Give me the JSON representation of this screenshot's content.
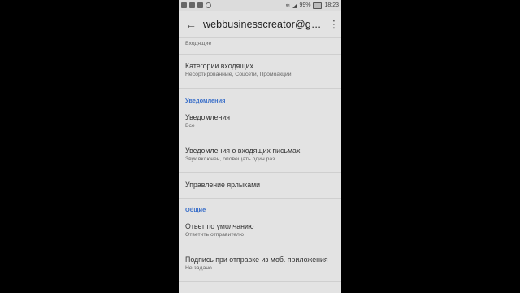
{
  "statusbar": {
    "battery_text": "99%",
    "time": "18:23"
  },
  "appbar": {
    "back_icon": "←",
    "title": "webbusinesscreator@gma...",
    "more_icon": "⋮"
  },
  "settings": {
    "item_partial": {
      "subtitle": "Входящие"
    },
    "inbox_categories": {
      "title": "Категории входящих",
      "subtitle": "Несортированные, Соцсети, Промоакции"
    },
    "section_notifications": "Уведомления",
    "notifications": {
      "title": "Уведомления",
      "subtitle": "Все"
    },
    "inbox_notifications": {
      "title": "Уведомления о входящих письмах",
      "subtitle": "Звук включен, оповещать один раз"
    },
    "manage_labels": {
      "title": "Управление ярлыками"
    },
    "section_general": "Общие",
    "default_reply": {
      "title": "Ответ по умолчанию",
      "subtitle": "Ответить отправителю"
    },
    "mobile_signature": {
      "title": "Подпись при отправке из моб. приложения",
      "subtitle": "Не задано"
    }
  }
}
